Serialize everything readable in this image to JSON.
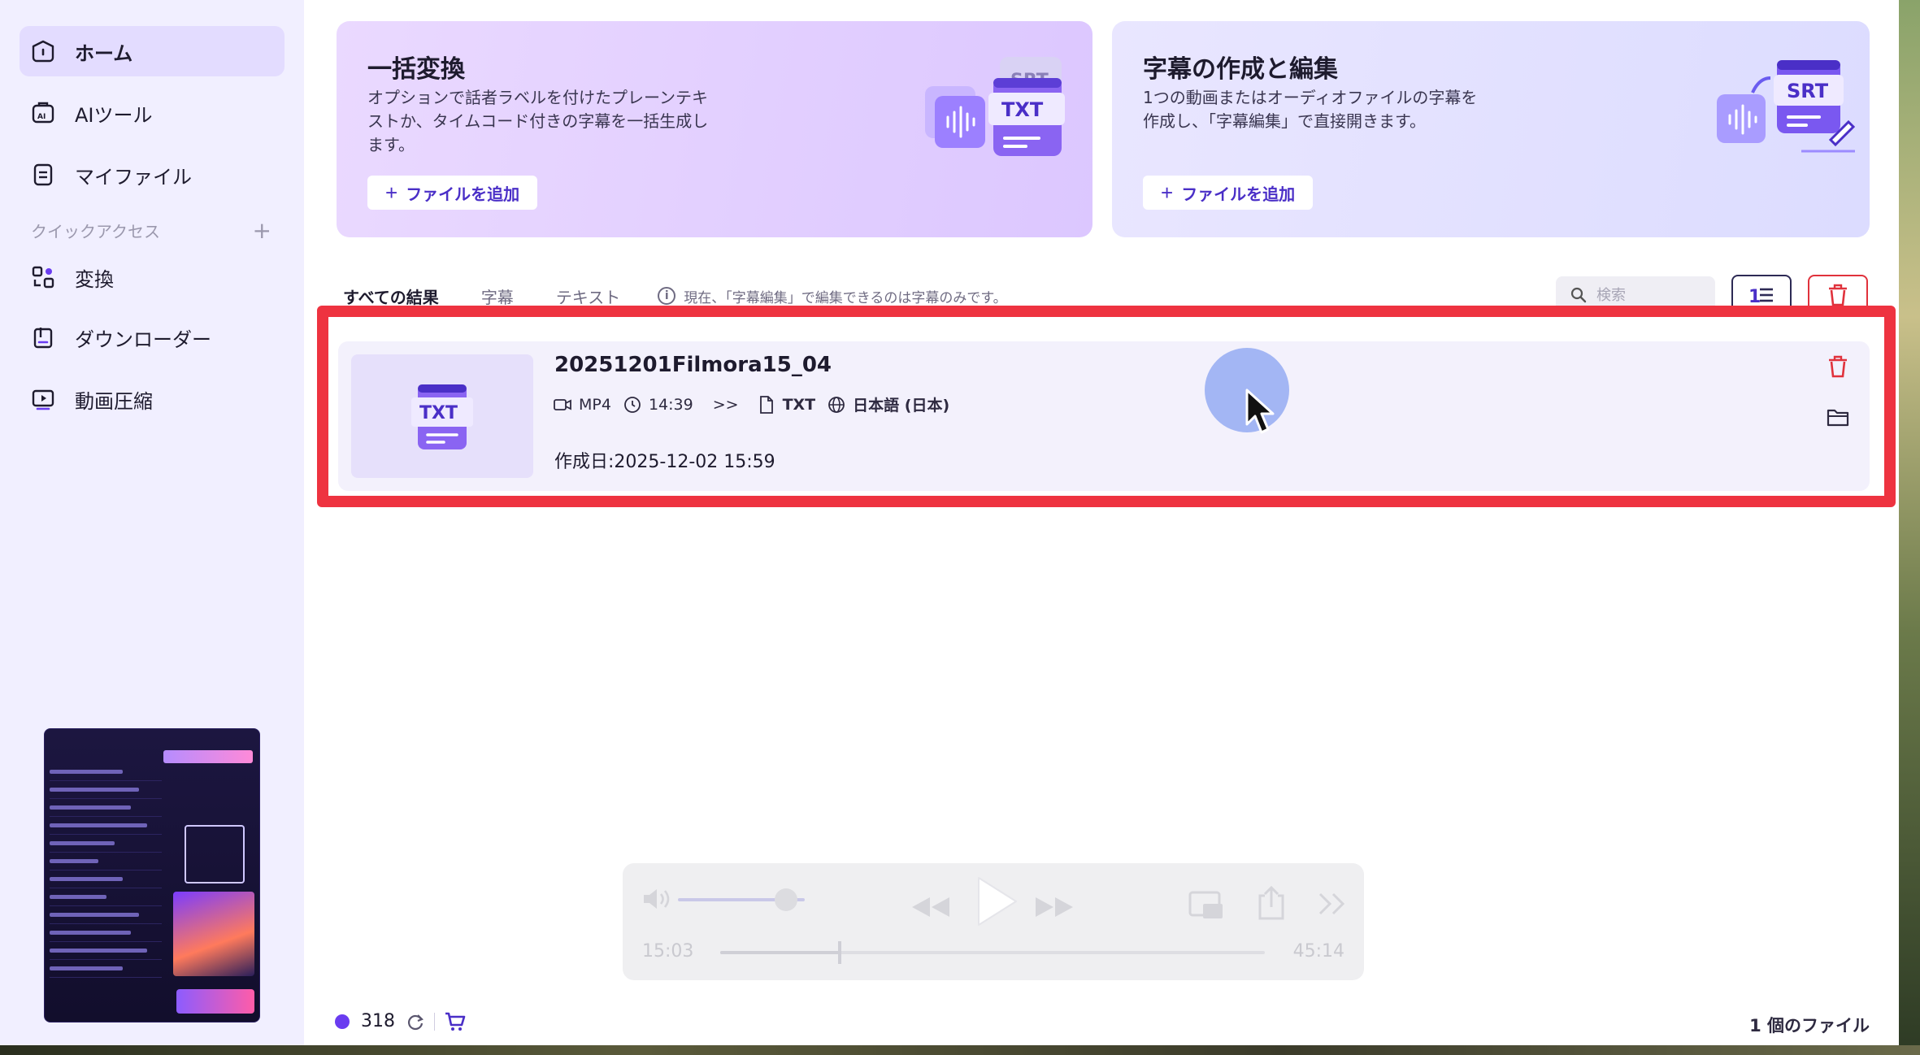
{
  "sidebar": {
    "items": [
      {
        "label": "ホーム",
        "icon": "home-icon",
        "active": true
      },
      {
        "label": "AIツール",
        "icon": "ai-tool-icon"
      },
      {
        "label": "マイファイル",
        "icon": "file-icon"
      }
    ],
    "quick_access_label": "クイックアクセス",
    "quick_items": [
      {
        "label": "変換",
        "icon": "convert-icon"
      },
      {
        "label": "ダウンローダー",
        "icon": "downloader-icon"
      },
      {
        "label": "動画圧縮",
        "icon": "compress-icon"
      }
    ]
  },
  "cards": {
    "batch": {
      "title": "一括変換",
      "desc": "オプションで話者ラベルを付けたプレーンテキストか、タイムコード付きの字幕を一括生成します。",
      "button": "ファイルを追加",
      "badge_srt": "SRT",
      "badge_txt": "TXT"
    },
    "subtitle": {
      "title": "字幕の作成と編集",
      "desc": "1つの動画またはオーディオファイルの字幕を作成し、「字幕編集」で直接開きます。",
      "button": "ファイルを追加",
      "badge_srt": "SRT"
    }
  },
  "tabs": [
    {
      "label": "すべての結果",
      "active": true
    },
    {
      "label": "字幕"
    },
    {
      "label": "テキスト"
    }
  ],
  "info_note": "現在、「字幕編集」で編集できるのは字幕のみです。",
  "search": {
    "placeholder": "検索"
  },
  "file": {
    "thumb_label": "TXT",
    "name": "20251201Filmora15_04",
    "source_format": "MP4",
    "duration": "14:39",
    "arrow": ">>",
    "output_format": "TXT",
    "language": "日本語 (日本)",
    "created": "作成日:2025-12-02 15:59"
  },
  "media": {
    "time_current": "15:03",
    "time_total": "45:14",
    "progress": 0.22,
    "volume": 0.85
  },
  "status": {
    "credits": "318",
    "file_count": "1 個のファイル"
  },
  "colors": {
    "accent": "#4a2fc7",
    "highlight": "#ee3340",
    "danger": "#e0323c"
  }
}
